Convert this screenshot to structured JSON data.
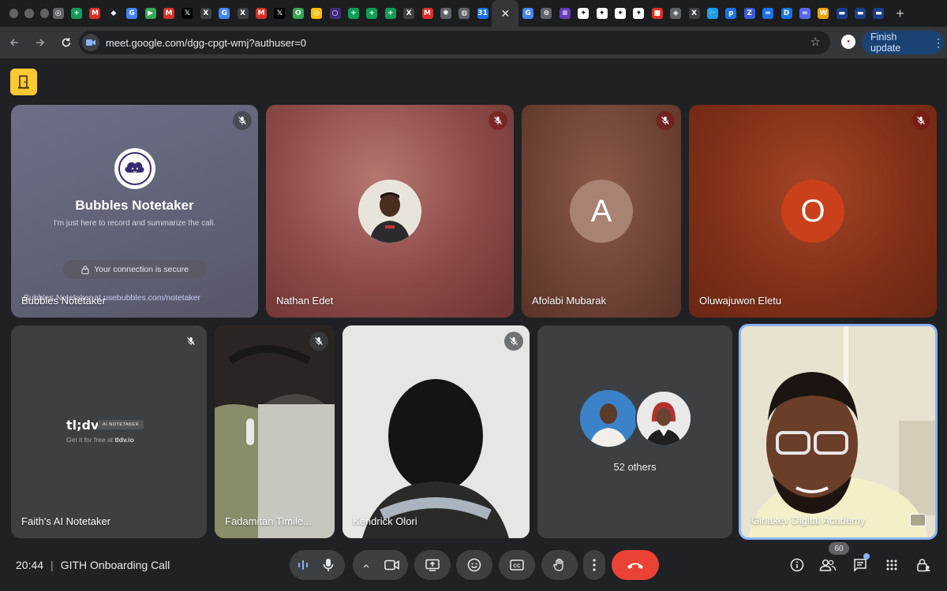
{
  "browser": {
    "tab_favicons": [
      {
        "icon": "chrome-icon",
        "color": "#5f6368",
        "glyph": "◎"
      },
      {
        "icon": "sheets-icon",
        "color": "#0f9d58",
        "glyph": "+"
      },
      {
        "icon": "gmail-icon",
        "color": "#d93025",
        "glyph": "M"
      },
      {
        "icon": "dark-diamond-icon",
        "color": "#202124",
        "glyph": "◆"
      },
      {
        "icon": "google-icon",
        "color": "#4285f4",
        "glyph": "G"
      },
      {
        "icon": "green-play-icon",
        "color": "#34a853",
        "glyph": "▶"
      },
      {
        "icon": "gmail-icon",
        "color": "#d93025",
        "glyph": "M"
      },
      {
        "icon": "x-icon",
        "color": "#000000",
        "glyph": "𝕏"
      },
      {
        "icon": "x-circle-icon",
        "color": "#3c4043",
        "glyph": "X"
      },
      {
        "icon": "google-icon",
        "color": "#4285f4",
        "glyph": "G"
      },
      {
        "icon": "x-circle-icon",
        "color": "#3c4043",
        "glyph": "X"
      },
      {
        "icon": "gmail-icon",
        "color": "#d93025",
        "glyph": "M"
      },
      {
        "icon": "x-icon",
        "color": "#000000",
        "glyph": "𝕏"
      },
      {
        "icon": "green-ring-icon",
        "color": "#34a853",
        "glyph": "O"
      },
      {
        "icon": "chrome-icon",
        "color": "#fbbc04",
        "glyph": "◎"
      },
      {
        "icon": "purple-circle-icon",
        "color": "#3f2b7a",
        "glyph": "○"
      },
      {
        "icon": "sheets-icon",
        "color": "#0f9d58",
        "glyph": "+"
      },
      {
        "icon": "sheets-icon",
        "color": "#0f9d58",
        "glyph": "+"
      },
      {
        "icon": "sheets-icon",
        "color": "#0f9d58",
        "glyph": "+"
      },
      {
        "icon": "x-circle-icon",
        "color": "#3c4043",
        "glyph": "X"
      },
      {
        "icon": "gmail-icon",
        "color": "#d93025",
        "glyph": "M"
      },
      {
        "icon": "openai-icon",
        "color": "#5f6368",
        "glyph": "✺"
      },
      {
        "icon": "globe-icon",
        "color": "#5f6368",
        "glyph": "◍"
      },
      {
        "icon": "calendar-icon",
        "color": "#1a73e8",
        "glyph": "31"
      }
    ],
    "tab_favicons_after": [
      {
        "icon": "google-icon",
        "color": "#4285f4",
        "glyph": "G"
      },
      {
        "icon": "minus-circle-icon",
        "color": "#5f6368",
        "glyph": "⊖"
      },
      {
        "icon": "forms-icon",
        "color": "#673ab7",
        "glyph": "≡"
      },
      {
        "icon": "notion-icon",
        "color": "#ffffff",
        "glyph": "✦"
      },
      {
        "icon": "notion-icon",
        "color": "#ffffff",
        "glyph": "✦"
      },
      {
        "icon": "notion-icon",
        "color": "#ffffff",
        "glyph": "✦"
      },
      {
        "icon": "notion-icon",
        "color": "#ffffff",
        "glyph": "✦"
      },
      {
        "icon": "red-square-icon",
        "color": "#d93025",
        "glyph": "■"
      },
      {
        "icon": "shield-icon",
        "color": "#5f6368",
        "glyph": "◈"
      },
      {
        "icon": "x-circle-icon",
        "color": "#3c4043",
        "glyph": "X"
      },
      {
        "icon": "twitter-icon",
        "color": "#1d9bf0",
        "glyph": "🐦"
      },
      {
        "icon": "blue-p-icon",
        "color": "#1a73e8",
        "glyph": "p"
      },
      {
        "icon": "blue-z-icon",
        "color": "#3b5bdb",
        "glyph": "Z"
      },
      {
        "icon": "link-icon",
        "color": "#1a73e8",
        "glyph": "∞"
      },
      {
        "icon": "d-icon",
        "color": "#1a73e8",
        "glyph": "D"
      },
      {
        "icon": "infinity-icon",
        "color": "#5865f2",
        "glyph": "∞"
      },
      {
        "icon": "w-icon",
        "color": "#f4a300",
        "glyph": "W"
      },
      {
        "icon": "dark-blue-icon",
        "color": "#1a3f8a",
        "glyph": "▬"
      },
      {
        "icon": "dark-blue-icon",
        "color": "#1a3f8a",
        "glyph": "▬"
      },
      {
        "icon": "dark-blue-icon",
        "color": "#1a3f8a",
        "glyph": "▬"
      }
    ],
    "url": "meet.google.com/dgg-cpgt-wmj?authuser=0",
    "update_button": "Finish update"
  },
  "tiles": {
    "bubbles": {
      "title": "Bubbles Notetaker",
      "subtitle": "I'm just here to record and summarize the call.",
      "secure": "Your connection is secure",
      "footer_prefix": "Bubbles Notetaker at",
      "footer_link": "usebubbles.com/notetaker",
      "name": "Bubbles Notetaker"
    },
    "nathan": {
      "name": "Nathan Edet"
    },
    "afolabi": {
      "name": "Afolabi Mubarak",
      "initial": "A"
    },
    "oluwajuwon": {
      "name": "Oluwajuwon Eletu",
      "initial": "O"
    },
    "faith": {
      "brand": "tl;dv",
      "badge": "AI NOTETAKER",
      "sub_prefix": "Get it for free at",
      "sub_link": "tldv.io",
      "name": "Faith's AI Notetaker"
    },
    "fadamitan": {
      "name": "Fadamitan Timile..."
    },
    "kendrick": {
      "name": "Kendrick Olori"
    },
    "others": {
      "label": "52 others"
    },
    "ginakev": {
      "name": "Ginakev Digital Academy"
    }
  },
  "bottom_bar": {
    "time": "20:44",
    "meeting_title": "GITH Onboarding Call",
    "participant_count": "60"
  },
  "colors": {
    "accent_blue": "#8ab4f8",
    "end_call_red": "#ea4335",
    "door_yellow": "#fcc934"
  }
}
